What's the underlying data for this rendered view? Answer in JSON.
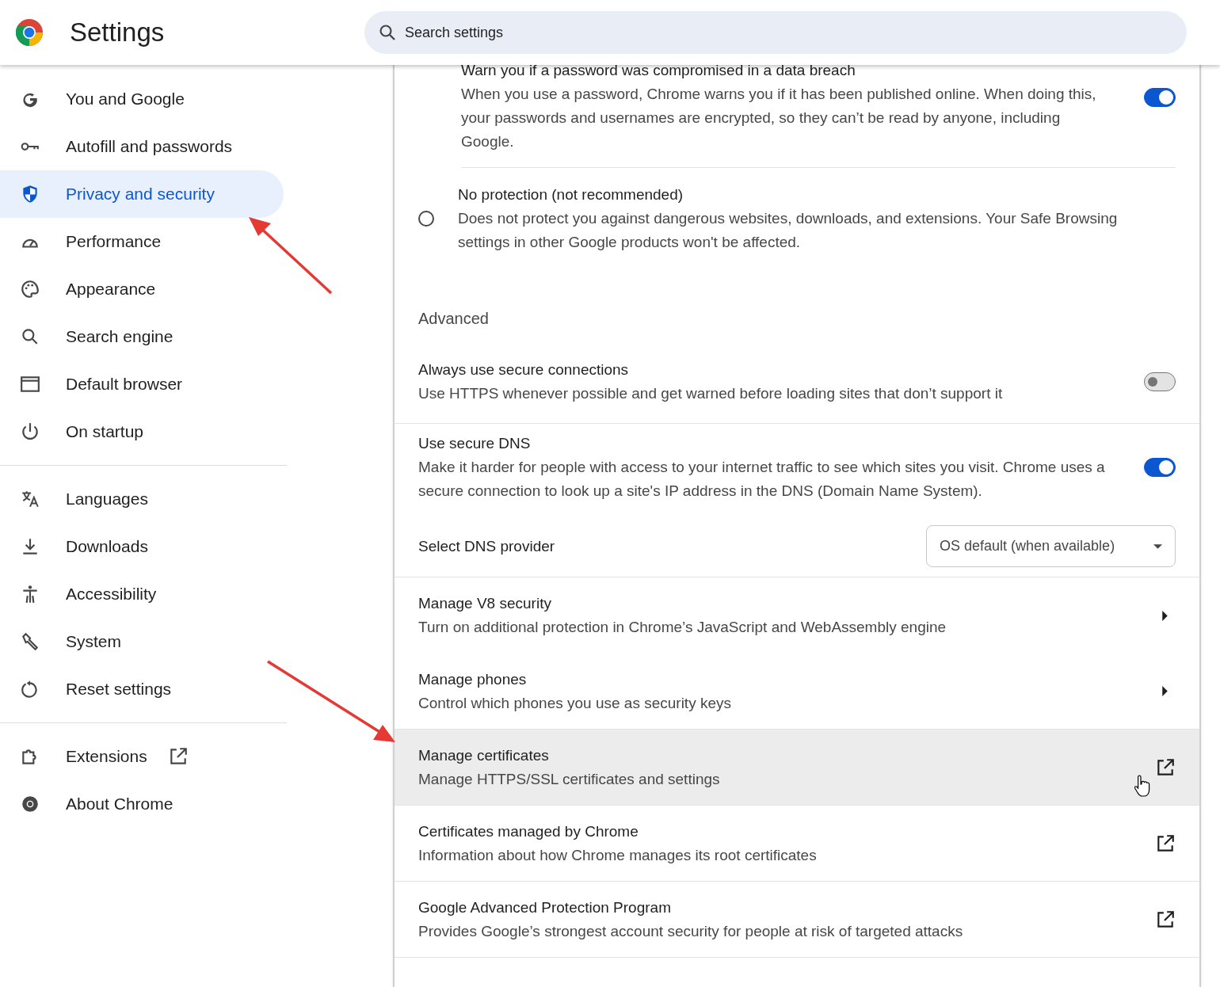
{
  "header": {
    "title": "Settings",
    "search": {
      "placeholder": "Search settings"
    }
  },
  "sidebar": {
    "sections": [
      {
        "items": [
          {
            "label": "You and Google",
            "selected": false,
            "external": false
          },
          {
            "label": "Autofill and passwords",
            "selected": false,
            "external": false
          },
          {
            "label": "Privacy and security",
            "selected": true,
            "external": false
          },
          {
            "label": "Performance",
            "selected": false,
            "external": false
          },
          {
            "label": "Appearance",
            "selected": false,
            "external": false
          },
          {
            "label": "Search engine",
            "selected": false,
            "external": false
          },
          {
            "label": "Default browser",
            "selected": false,
            "external": false
          },
          {
            "label": "On startup",
            "selected": false,
            "external": false
          }
        ]
      },
      {
        "items": [
          {
            "label": "Languages",
            "selected": false,
            "external": false
          },
          {
            "label": "Downloads",
            "selected": false,
            "external": false
          },
          {
            "label": "Accessibility",
            "selected": false,
            "external": false
          },
          {
            "label": "System",
            "selected": false,
            "external": false
          },
          {
            "label": "Reset settings",
            "selected": false,
            "external": false
          }
        ]
      },
      {
        "items": [
          {
            "label": "Extensions",
            "selected": false,
            "external": true
          },
          {
            "label": "About Chrome",
            "selected": false,
            "external": false
          }
        ]
      }
    ]
  },
  "content": {
    "rows": [
      {
        "kind": "subtoggle",
        "title": "Warn you if a password was compromised in a data breach",
        "description": "When you use a password, Chrome warns you if it has been published online. When doing this, your passwords and usernames are encrypted, so they can’t be read by anyone, including Google.",
        "on": true
      },
      {
        "kind": "radio",
        "title": "No protection (not recommended)",
        "description": "Does not protect you against dangerous websites, downloads, and extensions. Your Safe Browsing settings in other Google products won't be affected.",
        "selected": false
      },
      {
        "kind": "heading",
        "title": "Advanced"
      },
      {
        "kind": "toggle",
        "title": "Always use secure connections",
        "description": "Use HTTPS whenever possible and get warned before loading sites that don’t support it",
        "on": false
      },
      {
        "kind": "toggle",
        "title": "Use secure DNS",
        "description": "Make it harder for people with access to your internet traffic to see which sites you visit. Chrome uses a secure connection to look up a site's IP address in the DNS (Domain Name System).",
        "on": true
      },
      {
        "kind": "select",
        "title": "Select DNS provider",
        "value": "OS default (when available)"
      },
      {
        "kind": "arrow",
        "title": "Manage V8 security",
        "description": "Turn on additional protection in Chrome’s JavaScript and WebAssembly engine",
        "hovered": false
      },
      {
        "kind": "arrow",
        "title": "Manage phones",
        "description": "Control which phones you use as security keys",
        "hovered": false
      },
      {
        "kind": "external",
        "title": "Manage certificates",
        "description": "Manage HTTPS/SSL certificates and settings",
        "hovered": true
      },
      {
        "kind": "external",
        "title": "Certificates managed by Chrome",
        "description": "Information about how Chrome manages its root certificates",
        "hovered": false
      },
      {
        "kind": "external",
        "title": "Google Advanced Protection Program",
        "description": "Provides Google’s strongest account security for people at risk of targeted attacks",
        "hovered": false
      }
    ]
  }
}
